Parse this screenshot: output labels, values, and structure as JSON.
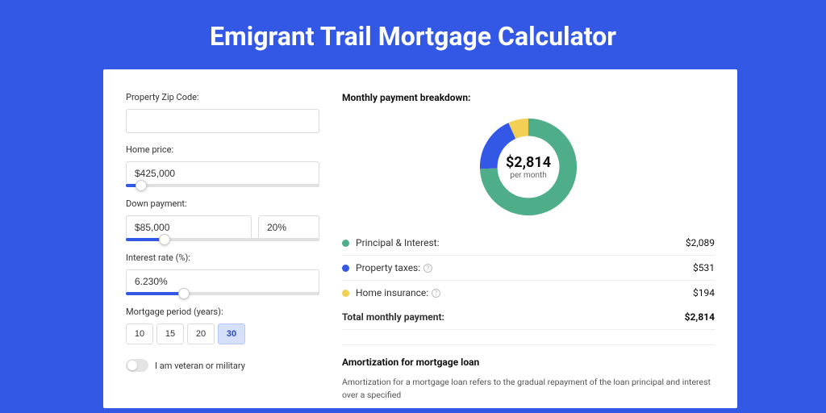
{
  "page_title": "Emigrant Trail Mortgage Calculator",
  "form": {
    "zip_label": "Property Zip Code:",
    "zip_value": "",
    "home_price_label": "Home price:",
    "home_price_value": "$425,000",
    "down_payment_label": "Down payment:",
    "down_payment_value": "$85,000",
    "down_payment_pct": "20%",
    "interest_label": "Interest rate (%):",
    "interest_value": "6.230%",
    "period_label": "Mortgage period (years):",
    "period_options": [
      "10",
      "15",
      "20",
      "30"
    ],
    "period_selected": "30",
    "veteran_label": "I am veteran or military"
  },
  "sliders": {
    "home_price_pct": 8,
    "down_payment_pct": 20,
    "interest_pct": 30
  },
  "breakdown": {
    "title": "Monthly payment breakdown:",
    "amount": "$2,814",
    "sub": "per month",
    "items": [
      {
        "label": "Principal & Interest:",
        "value": "$2,089",
        "color": "#4fae8a",
        "info": false
      },
      {
        "label": "Property taxes:",
        "value": "$531",
        "color": "#3358e6",
        "info": true
      },
      {
        "label": "Home insurance:",
        "value": "$194",
        "color": "#f3cf55",
        "info": true
      }
    ],
    "total_label": "Total monthly payment:",
    "total_value": "$2,814"
  },
  "chart_data": {
    "type": "pie",
    "title": "Monthly payment breakdown",
    "series": [
      {
        "name": "Principal & Interest",
        "value": 2089,
        "color": "#4fae8a"
      },
      {
        "name": "Property taxes",
        "value": 531,
        "color": "#3358e6"
      },
      {
        "name": "Home insurance",
        "value": 194,
        "color": "#f3cf55"
      }
    ],
    "total": 2814,
    "center_label": "$2,814",
    "center_sub": "per month"
  },
  "amort": {
    "title": "Amortization for mortgage loan",
    "text": "Amortization for a mortgage loan refers to the gradual repayment of the loan principal and interest over a specified"
  }
}
